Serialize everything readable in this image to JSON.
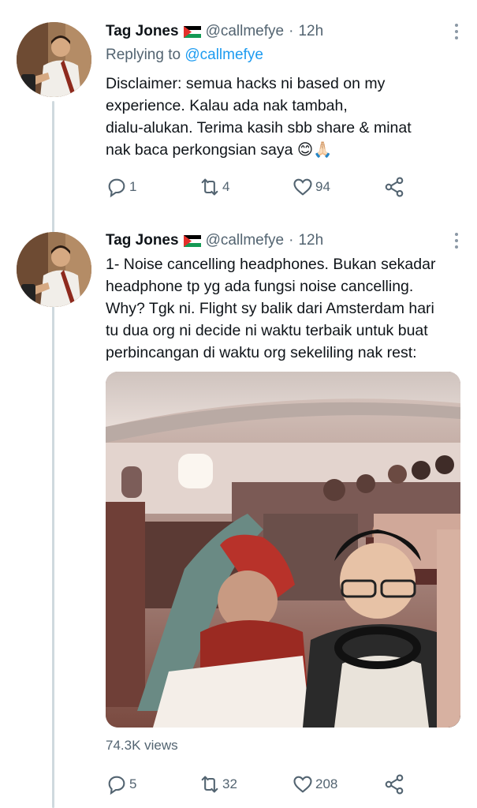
{
  "tweets": [
    {
      "author_name": "Tag Jones",
      "author_flag_icon": "palestine-flag-icon",
      "handle": "@callmefye",
      "separator": "·",
      "time": "12h",
      "replying_to_label": "Replying to",
      "replying_to_handle": "@callmefye",
      "text_lines": [
        "Disclaimer: semua hacks ni based on my",
        "experience. Kalau ada nak tambah,",
        "dialu-alukan.  Terima kasih sbb share & minat",
        "nak baca perkongsian saya 😊🙏🏻"
      ],
      "reply_count": "1",
      "retweet_count": "4",
      "like_count": "94"
    },
    {
      "author_name": "Tag Jones",
      "author_flag_icon": "palestine-flag-icon",
      "handle": "@callmefye",
      "separator": "·",
      "time": "12h",
      "text_lines": [
        "1- Noise cancelling headphones. Bukan sekadar",
        "headphone tp yg ada fungsi noise cancelling.",
        "Why? Tgk ni. Flight sy balik dari Amsterdam hari",
        "tu dua org ni decide ni waktu terbaik untuk buat",
        "perbincangan di waktu org sekeliling nak rest:"
      ],
      "views": "74.3K views",
      "reply_count": "5",
      "retweet_count": "32",
      "like_count": "208"
    }
  ],
  "icons": {
    "reply": "reply-icon",
    "retweet": "retweet-icon",
    "like": "heart-icon",
    "share": "share-icon",
    "more": "more-vertical-icon"
  },
  "colors": {
    "text": "#0f1419",
    "secondary": "#536471",
    "link": "#1d9bf0",
    "thread_line": "#cfd9de"
  }
}
